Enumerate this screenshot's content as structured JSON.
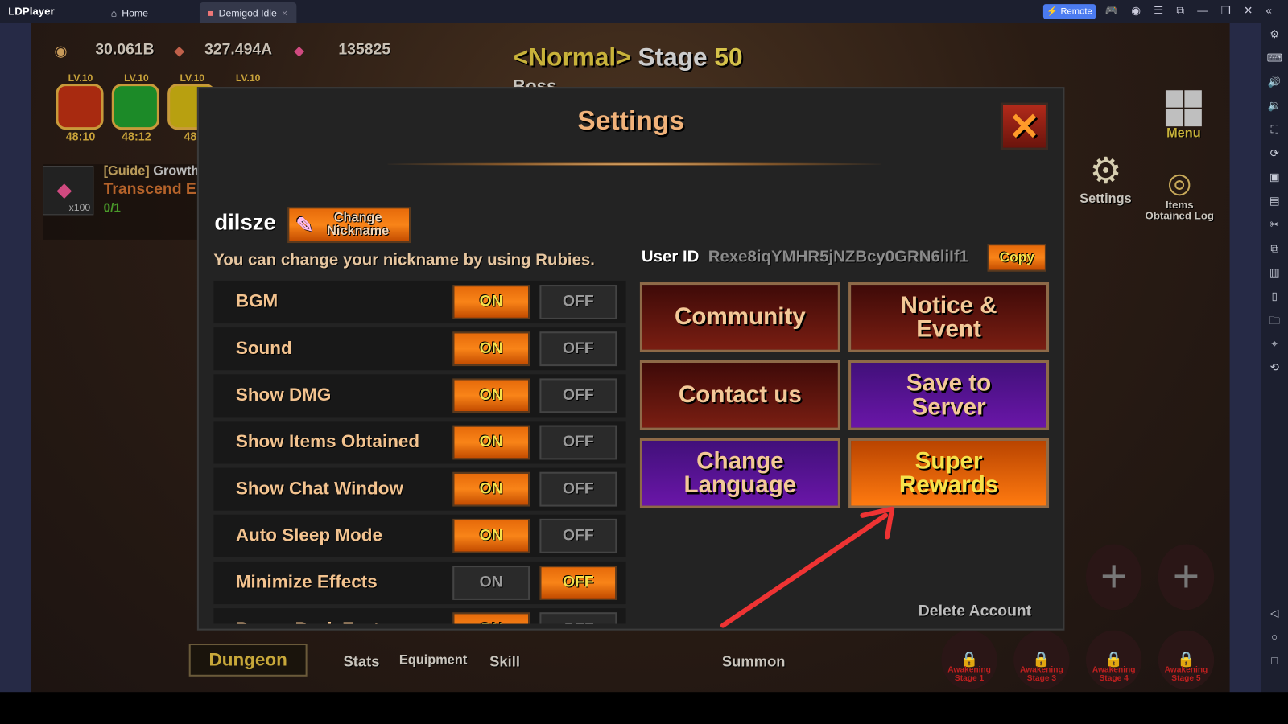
{
  "app": {
    "name": "LDPlayer",
    "tabs": [
      {
        "label": "Home"
      },
      {
        "label": "Demigod Idle"
      }
    ],
    "remote_label": "Remote",
    "accent": "#4b7bf0"
  },
  "sidebar_icons": [
    "settings-icon",
    "keyboard-icon",
    "volume-up-icon",
    "volume-down-icon",
    "screenshot-icon",
    "sync-icon",
    "record-icon",
    "apk-icon",
    "cut-icon",
    "multi-instance-icon",
    "operations-icon",
    "shake-icon",
    "folder-icon",
    "location-icon",
    "rotate-icon",
    "back-icon",
    "home-icon",
    "recents-icon"
  ],
  "hud": {
    "gold": "30.061B",
    "crystal": "327.494A",
    "ruby": "135825",
    "stage_mode": "<Normal>",
    "stage_label": "Stage",
    "stage_num": "50",
    "boss": "Boss",
    "levels": [
      {
        "lv": "LV.10",
        "time": "48:10"
      },
      {
        "lv": "LV.10",
        "time": "48:12"
      },
      {
        "lv": "LV.10",
        "time": "48:"
      },
      {
        "lv": "LV.10",
        "time": ""
      }
    ],
    "guide_tag": "[Guide]",
    "guide_title": "Growth",
    "guide_task": "Transcend E",
    "guide_progress": "0/1",
    "reward_qty": "x100",
    "menu": "Menu",
    "settings": "Settings",
    "items_log": "Items Obtained Log"
  },
  "bottom_nav": {
    "dungeon": "Dungeon",
    "stats": "Stats",
    "equipment": "Equipment",
    "skill": "Skill",
    "summon": "Summon",
    "awakening": [
      "Awakening Stage 1",
      "Awakening Stage 3",
      "Awakening Stage 4",
      "Awakening Stage 5"
    ]
  },
  "settings": {
    "title": "Settings",
    "nickname": "dilsze",
    "change_nickname": "Change Nickname",
    "nickname_hint": "You can change your nickname by using Rubies.",
    "user_id_label": "User ID",
    "user_id": "Rexe8iqYMHR5jNZBcy0GRN6liIf1",
    "copy": "Copy",
    "on_label": "ON",
    "off_label": "OFF",
    "options": [
      {
        "label": "BGM",
        "on": true
      },
      {
        "label": "Sound",
        "on": true
      },
      {
        "label": "Show DMG",
        "on": true
      },
      {
        "label": "Show Items Obtained",
        "on": true
      },
      {
        "label": "Show Chat Window",
        "on": true
      },
      {
        "label": "Auto Sleep Mode",
        "on": true
      },
      {
        "label": "Minimize Effects",
        "on": false
      },
      {
        "label": "Power Peak Feature",
        "on": true
      }
    ],
    "buttons": [
      {
        "label": "Community",
        "color": "#6a1a10"
      },
      {
        "label": "Notice & Event",
        "color": "#6a1a10"
      },
      {
        "label": "Contact us",
        "color": "#6a1a10"
      },
      {
        "label": "Save to Server",
        "color": "#5a14a0"
      },
      {
        "label": "Change Language",
        "color": "#5a14a0"
      },
      {
        "label": "Super Rewards",
        "color": "#f07010"
      }
    ],
    "delete_account": "Delete Account"
  },
  "annotation": {
    "arrow_color": "#ee3333"
  }
}
